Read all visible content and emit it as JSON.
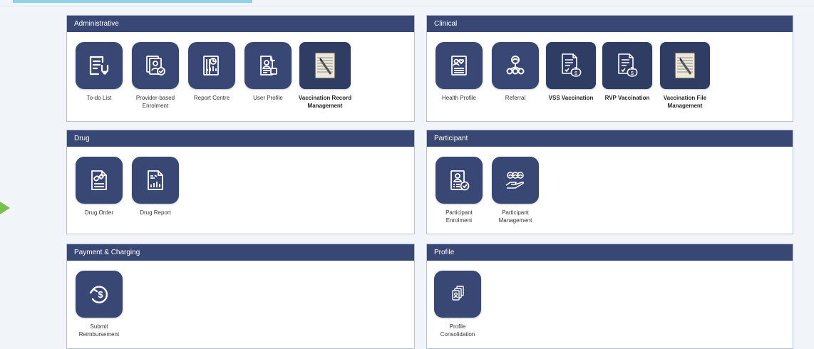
{
  "panels": {
    "administrative": {
      "title": "Administrative",
      "tiles": [
        {
          "label": "To-do List",
          "icon": "todo-list-icon"
        },
        {
          "label": "Provider-based\nEnrolment",
          "icon": "provider-enrolment-icon"
        },
        {
          "label": "Report Centre",
          "icon": "report-centre-icon"
        },
        {
          "label": "User Profile",
          "icon": "user-profile-icon"
        },
        {
          "label": "Vaccination Record\nManagement",
          "icon": "vaccination-record-icon"
        }
      ]
    },
    "clinical": {
      "title": "Clinical",
      "tiles": [
        {
          "label": "Health Profile",
          "icon": "health-profile-icon"
        },
        {
          "label": "Referral",
          "icon": "referral-icon"
        },
        {
          "label": "VSS Vaccination",
          "icon": "vss-vaccination-icon"
        },
        {
          "label": "RVP Vaccination",
          "icon": "rvp-vaccination-icon"
        },
        {
          "label": "Vaccination File\nManagement",
          "icon": "vaccination-file-icon"
        }
      ]
    },
    "drug": {
      "title": "Drug",
      "tiles": [
        {
          "label": "Drug Order",
          "icon": "drug-order-icon"
        },
        {
          "label": "Drug Report",
          "icon": "drug-report-icon"
        }
      ]
    },
    "participant": {
      "title": "Participant",
      "tiles": [
        {
          "label": "Participant\nEnrolment",
          "icon": "participant-enrolment-icon"
        },
        {
          "label": "Participant\nManagement",
          "icon": "participant-management-icon"
        }
      ]
    },
    "payment": {
      "title": "Payment & Charging",
      "tiles": [
        {
          "label": "Submit\nReimbursement",
          "icon": "reimbursement-icon"
        }
      ]
    },
    "profile": {
      "title": "Profile",
      "tiles": [
        {
          "label": "Profile\nConsolidation",
          "icon": "profile-consolidation-icon"
        }
      ]
    }
  },
  "colors": {
    "header": "#384773",
    "tile": "#384773",
    "background": "#f1f4f9",
    "accent_strip": "#8fd1e6",
    "arrow": "#7cbf4e"
  }
}
